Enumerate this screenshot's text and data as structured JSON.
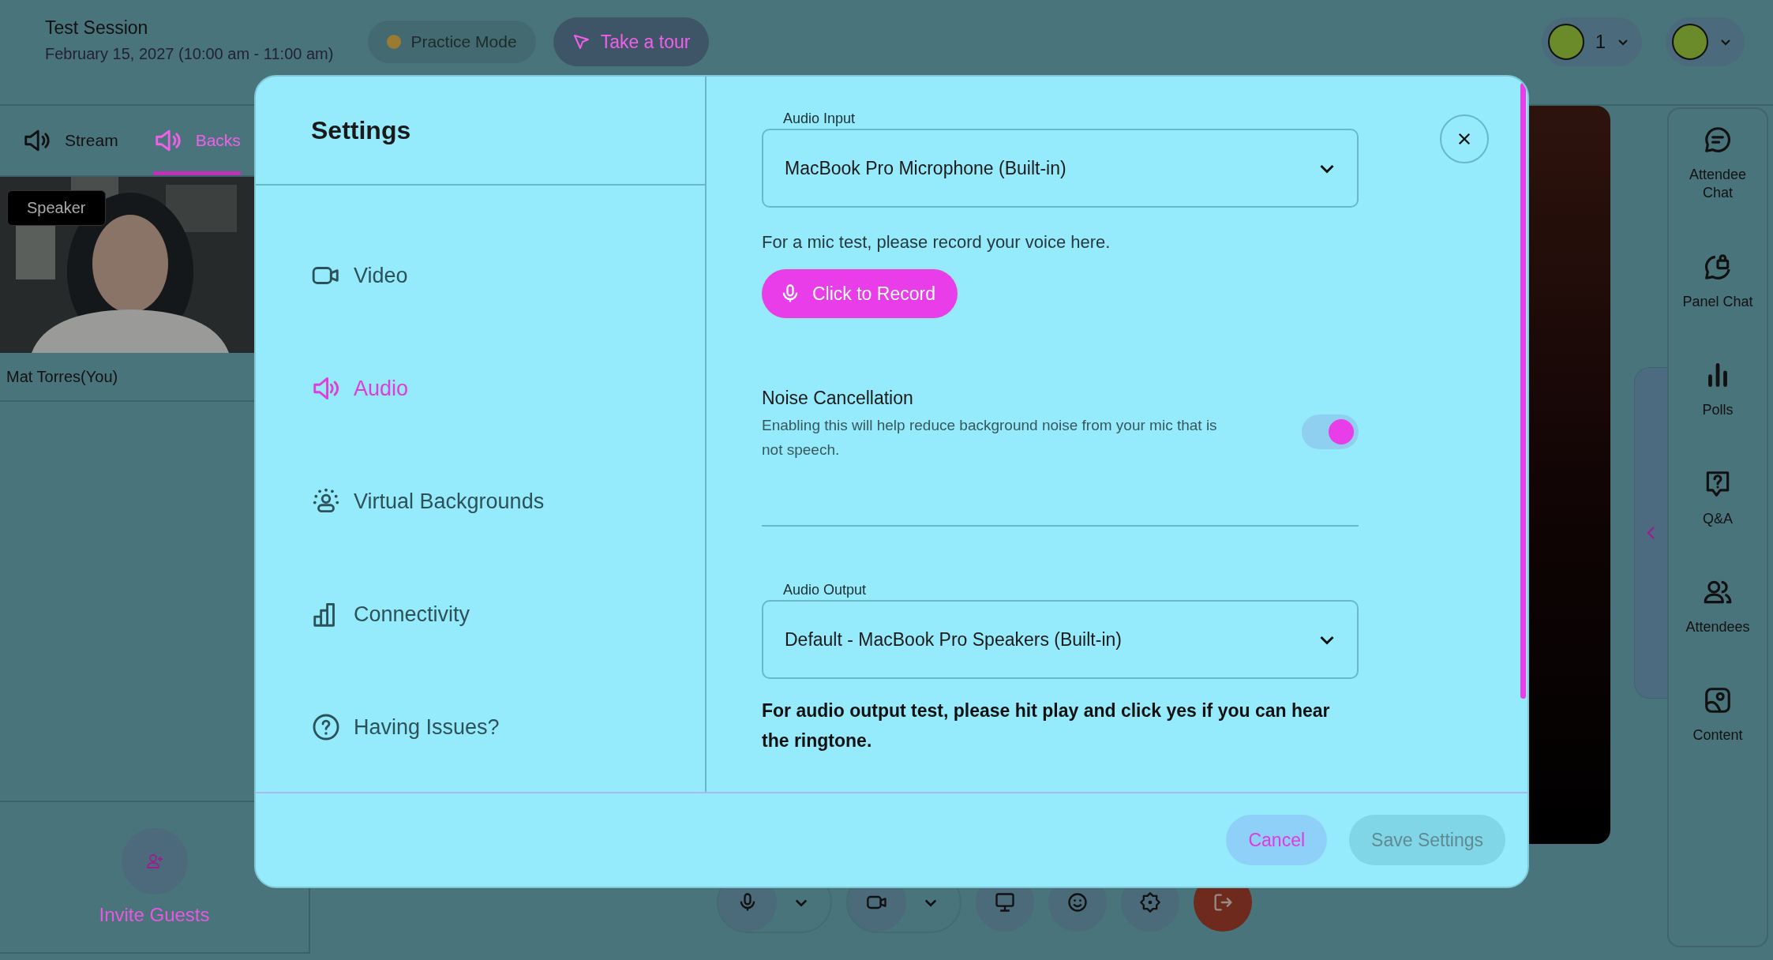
{
  "header": {
    "title": "Test Session",
    "date": "February 15, 2027 (10:00 am - 11:00 am)",
    "practice_mode": {
      "label": "Practice Mode",
      "color": "#9a7b32"
    },
    "tour_button": {
      "label": "Take a tour"
    },
    "participant_count": "1"
  },
  "left_panel": {
    "tabs": [
      {
        "label": "Stream",
        "selected": false
      },
      {
        "label": "Backs",
        "selected": true
      }
    ],
    "video_tile": {
      "kind": "picture",
      "badge": "Speaker",
      "name": "Mat Torres(You)"
    },
    "invite_button": {
      "label": "Invite Guests"
    }
  },
  "settings_dialog": {
    "title": "Settings",
    "nav": [
      {
        "label": "Video",
        "kind": "video",
        "selected": false
      },
      {
        "label": "Audio",
        "kind": "audio",
        "selected": true
      },
      {
        "label": "Virtual Backgrounds",
        "kind": "backgrounds",
        "selected": false
      },
      {
        "label": "Connectivity",
        "kind": "connectivity",
        "selected": false
      },
      {
        "label": "Having Issues?",
        "kind": "help",
        "selected": false
      }
    ],
    "audio_input": {
      "label": "Audio Input",
      "value": "MacBook Pro Microphone (Built-in)"
    },
    "mic_test_text": "For a mic test, please record your voice here.",
    "record_button": {
      "label": "Click to Record"
    },
    "noise_cancellation": {
      "title": "Noise Cancellation",
      "description": "Enabling this will help reduce background noise from your mic that is not speech.",
      "on": true
    },
    "audio_output": {
      "label": "Audio Output",
      "value": "Default - MacBook Pro Speakers (Built-in)"
    },
    "output_test_text": "For audio output test, please hit play and click yes if you can hear the ringtone.",
    "buttons": {
      "cancel": "Cancel",
      "save": "Save Settings"
    }
  },
  "sidebar": {
    "items": [
      {
        "label": "Attendee Chat",
        "kind": "chat"
      },
      {
        "label": "Panel Chat",
        "kind": "lock-chat"
      },
      {
        "label": "Polls",
        "kind": "polls"
      },
      {
        "label": "Q&A",
        "kind": "qa"
      },
      {
        "label": "Attendees",
        "kind": "people"
      },
      {
        "label": "Content",
        "kind": "content"
      }
    ]
  }
}
